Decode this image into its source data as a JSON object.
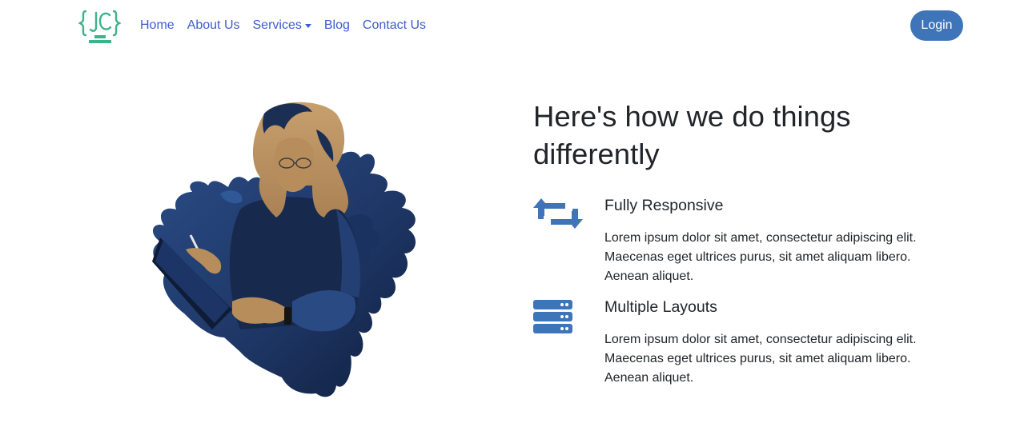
{
  "brand": {
    "logo_text": "JC",
    "icon": "jc-code-logo-icon",
    "color": "#3cb38a"
  },
  "nav": {
    "items": [
      {
        "label": "Home"
      },
      {
        "label": "About Us"
      },
      {
        "label": "Services",
        "dropdown": true
      },
      {
        "label": "Blog"
      },
      {
        "label": "Contact Us"
      }
    ],
    "link_color": "#3d5ccf",
    "login_label": "Login",
    "login_color": "#3e74b8"
  },
  "illustration": {
    "icon": "woman-with-tablet-illustration"
  },
  "main": {
    "heading": "Here's how we do things differently",
    "features": [
      {
        "icon": "repeat-arrows-icon",
        "title": "Fully Responsive",
        "text": "Lorem ipsum dolor sit amet, consectetur adipiscing elit. Maecenas eget ultrices purus, sit amet aliquam libero. Aenean aliquet."
      },
      {
        "icon": "server-stack-icon",
        "title": "Multiple Layouts",
        "text": "Lorem ipsum dolor sit amet, consectetur adipiscing elit. Maecenas eget ultrices purus, sit amet aliquam libero. Aenean aliquet."
      }
    ],
    "icon_color": "#3e74b8"
  }
}
